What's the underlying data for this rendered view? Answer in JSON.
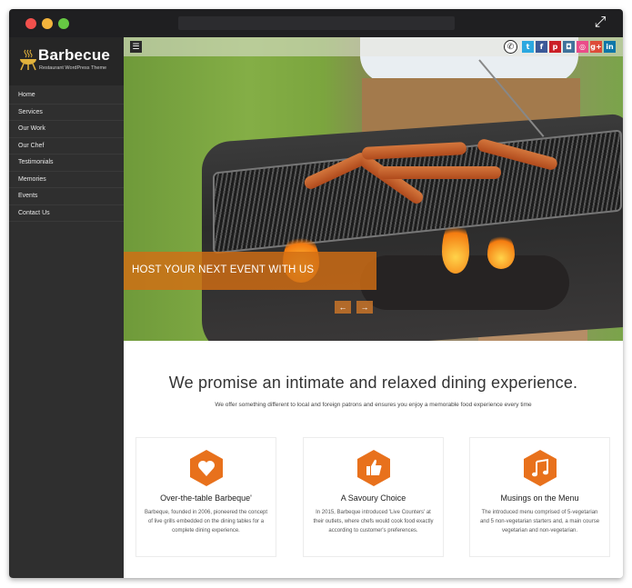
{
  "window": {
    "controls": [
      "close",
      "minimize",
      "maximize"
    ],
    "expand_icon": "expand-arrows-icon"
  },
  "sidebar": {
    "logo": {
      "title": "Barbecue",
      "subtitle": "Restaurant WordPress Theme",
      "icon": "grill-icon"
    },
    "items": [
      {
        "label": "Home"
      },
      {
        "label": "Services"
      },
      {
        "label": "Our Work"
      },
      {
        "label": "Our Chef"
      },
      {
        "label": "Testimonials"
      },
      {
        "label": "Memories"
      },
      {
        "label": "Events"
      },
      {
        "label": "Contact Us"
      }
    ]
  },
  "topbar": {
    "menu_icon": "☰",
    "phone_icon": "✆",
    "social": [
      {
        "name": "twitter",
        "glyph": "t",
        "color": "#2ca8e0"
      },
      {
        "name": "facebook",
        "glyph": "f",
        "color": "#3b5998"
      },
      {
        "name": "pinterest",
        "glyph": "p",
        "color": "#cb2027"
      },
      {
        "name": "instagram",
        "glyph": "◘",
        "color": "#3f729b"
      },
      {
        "name": "dribbble",
        "glyph": "◎",
        "color": "#ea4c89"
      },
      {
        "name": "google-plus",
        "glyph": "g+",
        "color": "#dd4b39"
      },
      {
        "name": "linkedin",
        "glyph": "in",
        "color": "#0e76a8"
      }
    ]
  },
  "hero": {
    "caption": "HOST YOUR NEXT EVENT WITH US",
    "prev_label": "←",
    "next_label": "→"
  },
  "intro": {
    "title": "We promise an intimate and relaxed dining experience.",
    "subtitle": "We offer something different to local and foreign patrons and ensures you enjoy a memorable food experience every time"
  },
  "features": [
    {
      "icon": "heart-icon",
      "glyph": "♥",
      "title": "Over-the-table Barbeque'",
      "text": "Barbeque, founded in 2006, pioneered the concept of live grills embedded on the dining tables for a complete dining experience."
    },
    {
      "icon": "thumbs-up-icon",
      "glyph": "👍",
      "title": "A Savoury Choice",
      "text": "In 2015, Barbeque introduced 'Live Counters' at their outlets, where chefs would cook food exactly according to customer's preferences."
    },
    {
      "icon": "music-icon",
      "glyph": "♫",
      "title": "Musings on the Menu",
      "text": "The introduced menu comprised of 5-vegetarian and 5 non-vegetarian starters and, a main course vegetarian and non-vegetarian."
    }
  ],
  "colors": {
    "accent": "#e8711c",
    "sidebar_bg": "#2f2f2f",
    "titlebar_bg": "#1f1f21"
  }
}
